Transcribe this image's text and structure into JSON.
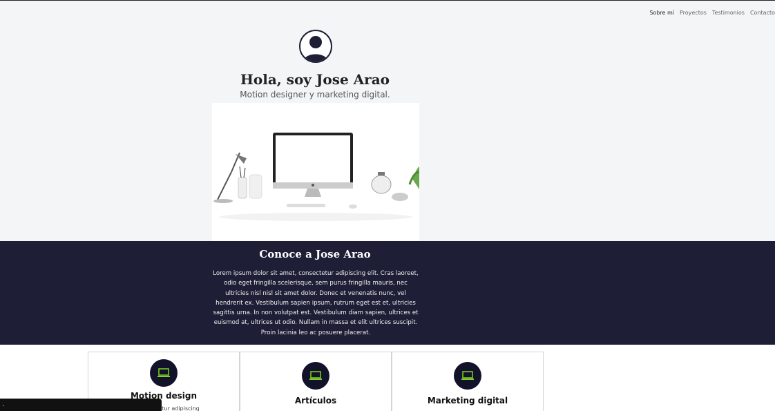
{
  "nav": {
    "items": [
      "Sobre mí",
      "Proyectos",
      "Testimonios",
      "Contacto"
    ]
  },
  "hero": {
    "title": "Hola, soy Jose Arao",
    "subtitle": "Motion designer y marketing digital."
  },
  "about": {
    "title": "Conoce a Jose Arao",
    "body": "Lorem ipsum dolor sit amet, consectetur adipiscing elit. Cras laoreet, odio eget fringilla scelerisque, sem purus fringilla mauris, nec ultricies nisl nisl sit amet dolor. Donec et venenatis nunc, vel hendrerit ex. Vestibulum sapien ipsum, rutrum eget est et, ultricies sagittis urna. In non volutpat est. Vestibulum diam sapien, ultrices et euismod at, ultrices ut odio. Nullam in massa et elit ultrices suscipit. Proin lacinia leo ac posuere placerat."
  },
  "services": {
    "cards": [
      {
        "title": "Motion design",
        "text": "et, consectetur adipiscing",
        "icon": "laptop-icon"
      },
      {
        "title": "Artículos",
        "text": "",
        "icon": "laptop-icon"
      },
      {
        "title": "Marketing digital",
        "text": "",
        "icon": "laptop-icon"
      }
    ]
  },
  "footer": {
    "text": "."
  },
  "colors": {
    "navy": "#1e1f36",
    "accent_green": "#7ed321",
    "background": "#f4f5f7"
  }
}
